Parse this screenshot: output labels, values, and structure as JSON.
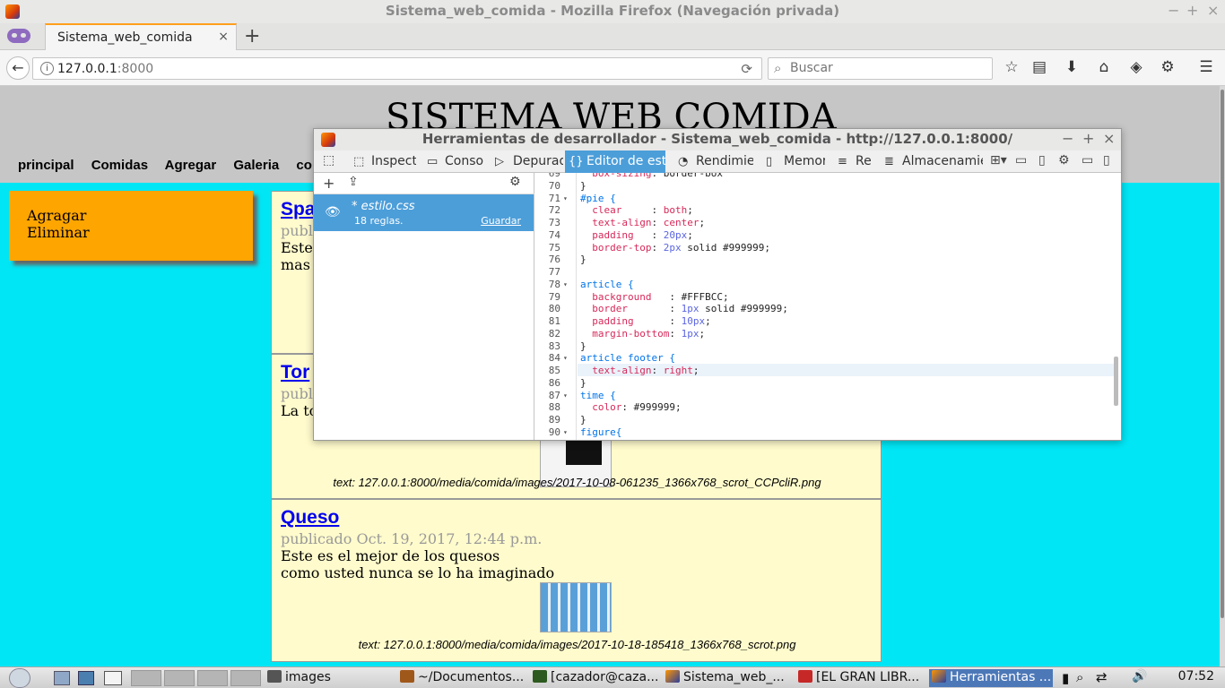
{
  "browser": {
    "window_title": "Sistema_web_comida - Mozilla Firefox (Navegación privada)",
    "tab_title": "Sistema_web_comida",
    "tab_close": "×",
    "new_tab": "+",
    "url_host": "127.0.0.1",
    "url_port": ":8000",
    "search_placeholder": "Buscar",
    "window_controls": [
      "−",
      "+",
      "×"
    ],
    "back": "←",
    "reload": "⟳",
    "info": "i",
    "search_glyph": "⌕",
    "menu_glyph": "☰",
    "toolbar_icons": [
      "star-icon",
      "reading-list-icon",
      "download-icon",
      "home-icon",
      "pocket-icon",
      "extension-icon",
      "menu-icon"
    ],
    "toolbar_glyphs": [
      "☆",
      "▤",
      "⬇",
      "⌂",
      "◈",
      "⚙"
    ]
  },
  "site": {
    "title": "SISTEMA WEB COMIDA",
    "menu": [
      "principal",
      "Comidas",
      "Agregar",
      "Galeria",
      "co"
    ],
    "aside_links": [
      "Agragar",
      "Eliminar"
    ],
    "articles": [
      {
        "title": "Spa",
        "published": "publ",
        "body_lines": [
          "Este",
          "mas"
        ]
      },
      {
        "title": "Tor",
        "published": "publ",
        "body_lines": [
          "La to"
        ],
        "caption": "text: 127.0.0.1:8000/media/comida/images/2017-10-08-061235_1366x768_scrot_CCPcliR.png"
      },
      {
        "title": "Queso",
        "published": "publicado Oct. 19, 2017, 12:44 p.m.",
        "body_lines": [
          "Este es el mejor de los quesos",
          "como usted nunca se lo ha imaginado"
        ],
        "caption": "text: 127.0.0.1:8000/media/comida/images/2017-10-18-185418_1366x768_scrot.png"
      }
    ]
  },
  "devtools": {
    "title": "Herramientas de desarrollador - Sistema_web_comida - http://127.0.0.1:8000/",
    "window_controls": [
      "−",
      "+",
      "×"
    ],
    "tabs": [
      {
        "icon": "inspector-icon",
        "glyph": "⬚",
        "label": "Inspector"
      },
      {
        "icon": "console-icon",
        "glyph": "▭",
        "label": "Consola"
      },
      {
        "icon": "debugger-icon",
        "glyph": "▷",
        "label": "Depurador"
      },
      {
        "icon": "style-editor-icon",
        "glyph": "{}",
        "label": "Editor de estilos",
        "selected": true
      },
      {
        "icon": "performance-icon",
        "glyph": "◔",
        "label": "Rendimiento"
      },
      {
        "icon": "memory-icon",
        "glyph": "▯",
        "label": "Memoria"
      },
      {
        "icon": "network-icon",
        "glyph": "≡",
        "label": "Red"
      },
      {
        "icon": "storage-icon",
        "glyph": "≣",
        "label": "Almacenamiento"
      }
    ],
    "toolbar_glyphs": [
      "⊞▾",
      "▭",
      "▯",
      "⚙",
      "▭",
      "▯"
    ],
    "sidebar_tools": [
      "+",
      "⇪",
      "⚙"
    ],
    "stylesheet": {
      "eye": "👁",
      "name": "* estilo.css",
      "rules": "18 reglas.",
      "save": "Guardar"
    },
    "code_lines": [
      {
        "n": "69",
        "t": "  box-sizing: border-box"
      },
      {
        "n": "70",
        "t": "}"
      },
      {
        "n": "71",
        "t": "#pie {",
        "fold": true
      },
      {
        "n": "72",
        "t": "  clear     : both;"
      },
      {
        "n": "73",
        "t": "  text-align: center;"
      },
      {
        "n": "74",
        "t": "  padding   : 20px;"
      },
      {
        "n": "75",
        "t": "  border-top: 2px solid #999999;"
      },
      {
        "n": "76",
        "t": "}"
      },
      {
        "n": "77",
        "t": ""
      },
      {
        "n": "78",
        "t": "article {",
        "fold": true
      },
      {
        "n": "79",
        "t": "  background   : #FFFBCC;"
      },
      {
        "n": "80",
        "t": "  border       : 1px solid #999999;"
      },
      {
        "n": "81",
        "t": "  padding      : 10px;"
      },
      {
        "n": "82",
        "t": "  margin-bottom: 1px;"
      },
      {
        "n": "83",
        "t": "}"
      },
      {
        "n": "84",
        "t": "article footer {",
        "fold": true
      },
      {
        "n": "85",
        "t": "  text-align: right;",
        "highlight": true
      },
      {
        "n": "86",
        "t": "}"
      },
      {
        "n": "87",
        "t": "time {",
        "fold": true
      },
      {
        "n": "88",
        "t": "  color: #999999;"
      },
      {
        "n": "89",
        "t": "}"
      },
      {
        "n": "90",
        "t": "figure{",
        "fold": true
      }
    ]
  },
  "taskbar": {
    "items": [
      {
        "icon": "folder-icon",
        "label": "images"
      },
      {
        "icon": "file-manager-icon",
        "label": "~/Documentos..."
      },
      {
        "icon": "terminal-icon",
        "label": "[cazador@caza..."
      },
      {
        "icon": "firefox-icon",
        "label": "Sistema_web_..."
      },
      {
        "icon": "pdf-icon",
        "label": "[EL GRAN LIBR..."
      },
      {
        "icon": "firefox-icon",
        "label": "Herramientas ..."
      }
    ],
    "tray_glyphs": [
      "⌕",
      "⇄",
      "🔊"
    ],
    "clock": "07:52"
  },
  "colors": {
    "page_bg": "#00e6f5",
    "header_bg": "#c6c6c6",
    "aside_bg": "#ffa500",
    "article_bg": "#fffbcc",
    "devtools_accent": "#4c9ed9"
  }
}
